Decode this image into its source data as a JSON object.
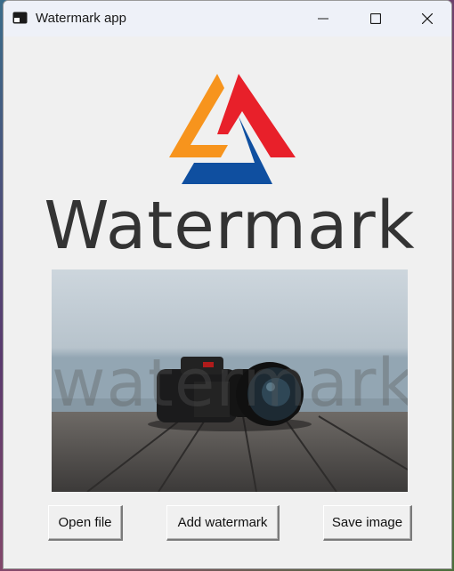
{
  "window": {
    "title": "Watermark app"
  },
  "logo": {
    "wordmark": "Watermark",
    "colors": {
      "orange": "#f7941d",
      "red": "#e8202a",
      "blue": "#0f4fa0"
    }
  },
  "image": {
    "watermark_text": "watermark"
  },
  "buttons": {
    "open": "Open file",
    "add": "Add watermark",
    "save": "Save image"
  },
  "icons": {
    "app": "app-window-icon",
    "minimize": "minimize-icon",
    "maximize": "maximize-icon",
    "close": "close-icon"
  }
}
